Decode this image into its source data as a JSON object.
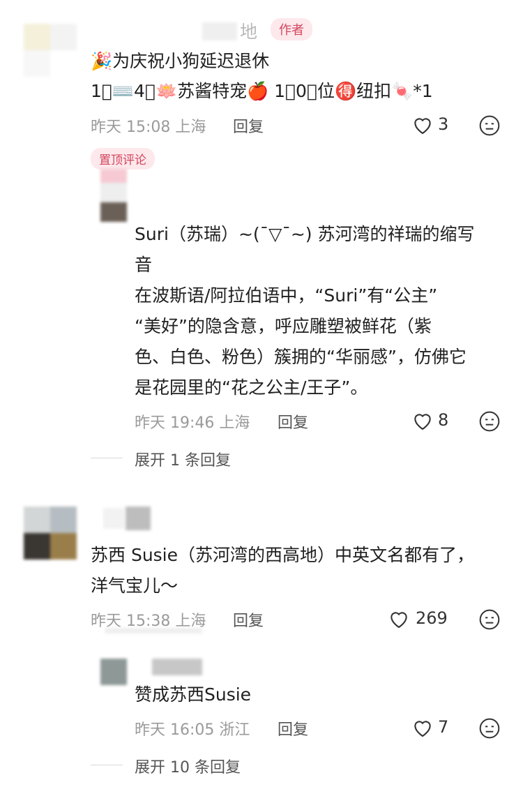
{
  "comments": [
    {
      "author_name": "地",
      "author_badge": "作者",
      "text": "🎉为庆祝小狗延迟退休",
      "text_line2": "1⃣⌨️4⃣🪷苏酱特宠🍎 1⃣0⃣位🉐纽扣🍬*1",
      "meta": "昨天 15:08 上海",
      "reply_label": "回复",
      "likes": "3",
      "pinned_badge": "置顶评论",
      "replies": [
        {
          "lines": [
            "Suri（苏瑞）~(¯▽¯~) 苏河湾的祥瑞的缩写",
            "音",
            "在波斯语/阿拉伯语中，“Suri”有“公主”",
            "“美好”的隐含意，呼应雕塑被鲜花（紫",
            "色、白色、粉色）簇拥的“华丽感”，仿佛它",
            "是花园里的“花之公主/王子”。"
          ],
          "meta": "昨天 19:46 上海",
          "reply_label": "回复",
          "likes": "8"
        }
      ],
      "expand_label": "展开 1 条回复"
    },
    {
      "text": "苏西 Susie（苏河湾的西高地）中英文名都有了，",
      "text_line2": "洋气宝儿～",
      "meta": "昨天 15:38 上海",
      "reply_label": "回复",
      "likes": "269",
      "replies": [
        {
          "lines": [
            "赞成苏西Susie"
          ],
          "meta": "昨天 16:05 浙江",
          "reply_label": "回复",
          "likes": "7"
        }
      ],
      "expand_label": "展开 10 条回复"
    }
  ],
  "colors": {
    "badge_bg": "#fde8ec",
    "badge_text": "#d2465d",
    "icon": "#333333"
  },
  "icons": [
    "heart-icon",
    "dislike-face-icon"
  ]
}
